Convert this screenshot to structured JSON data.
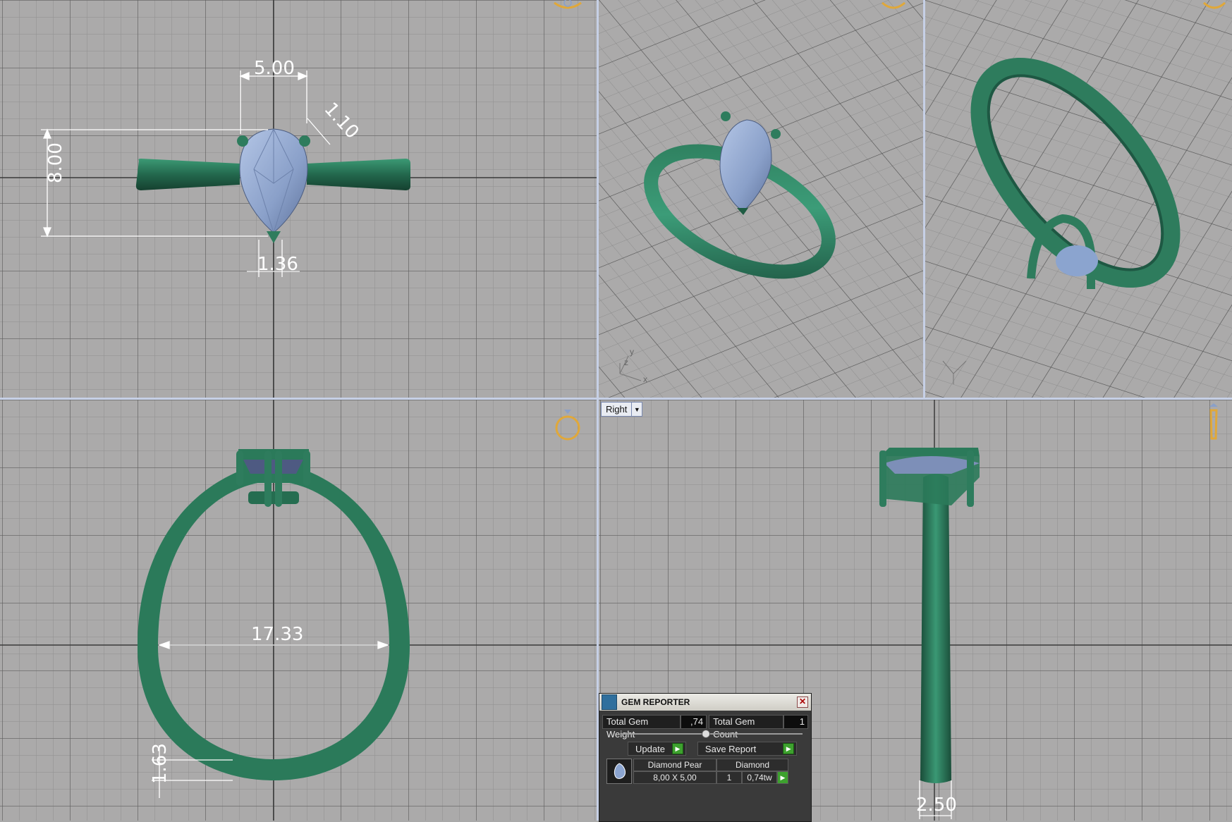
{
  "viewports": {
    "top": {
      "dims": {
        "width": "5.00",
        "prong": "1.10",
        "height": "8.00",
        "tip": "1.36"
      }
    },
    "front": {
      "dims": {
        "inner_diameter": "17.33",
        "band_thickness": "1.63"
      }
    },
    "right": {
      "view_label": "Right",
      "dims": {
        "band_width": "2.50"
      }
    },
    "axes": {
      "x": "x",
      "y": "y",
      "z": "z"
    }
  },
  "gem_reporter": {
    "title": "GEM REPORTER",
    "total_weight_label": "Total Gem Weight",
    "total_weight_value": ",74",
    "total_count_label": "Total Gem Count",
    "total_count_value": "1",
    "update_label": "Update",
    "save_label": "Save Report",
    "rows": [
      {
        "name": "Diamond Pear",
        "material": "Diamond",
        "size": "8,00 X 5,00",
        "count": "1",
        "weight": "0,74tw"
      }
    ]
  },
  "colors": {
    "metal": "#2e7c5d",
    "gem": "#8ba4cf",
    "grid_bg": "#abaaaa",
    "dim_line": "#ffffff"
  }
}
